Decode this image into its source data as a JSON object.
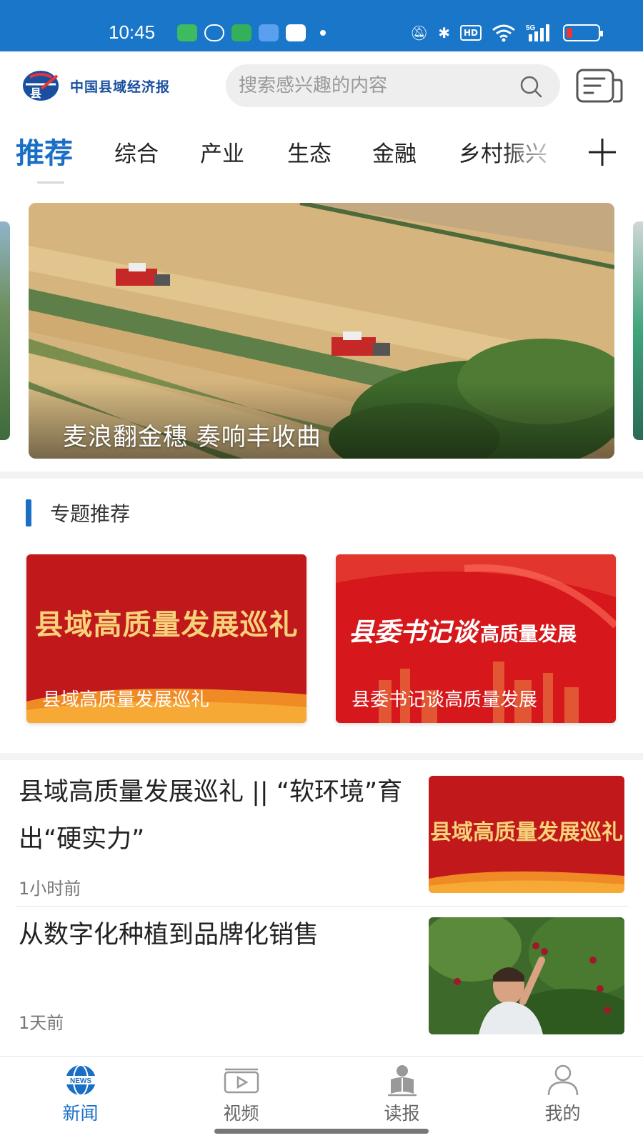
{
  "status_bar": {
    "time": "10:45",
    "network": "5G",
    "hd_label": "HD"
  },
  "header": {
    "logo_text": "中国县域经济报",
    "search": {
      "placeholder": "搜索感兴趣的内容"
    }
  },
  "channels": {
    "active": "推荐",
    "tabs": [
      "推荐",
      "综合",
      "产业",
      "生态",
      "金融",
      "乡村振兴"
    ]
  },
  "banner": {
    "title": "麦浪翻金穗 奏响丰收曲"
  },
  "topics": {
    "title": "专题推荐",
    "cards": [
      {
        "art_text": "县域高质量发展巡礼",
        "label": "县域高质量发展巡礼"
      },
      {
        "art_big": "县委书记谈",
        "art_small": "高质量发展",
        "label": "县委书记谈高质量发展"
      }
    ]
  },
  "news": [
    {
      "title": "县域高质量发展巡礼 || “软环境”育出“硬实力”",
      "time": "1小时前",
      "thumb_text": "县域高质量发展巡礼"
    },
    {
      "title": "从数字化种植到品牌化销售",
      "time": "1天前"
    }
  ],
  "bottom_nav": {
    "items": [
      {
        "label": "新闻",
        "icon": "news-globe-icon",
        "active": true
      },
      {
        "label": "视频",
        "icon": "video-icon",
        "active": false
      },
      {
        "label": "读报",
        "icon": "read-paper-icon",
        "active": false
      },
      {
        "label": "我的",
        "icon": "profile-icon",
        "active": false
      }
    ]
  },
  "colors": {
    "status_bar": "#1976c8",
    "accent": "#1a6fc5",
    "topic_red": "#c1181b",
    "topic_gold": "#f6d37a"
  }
}
